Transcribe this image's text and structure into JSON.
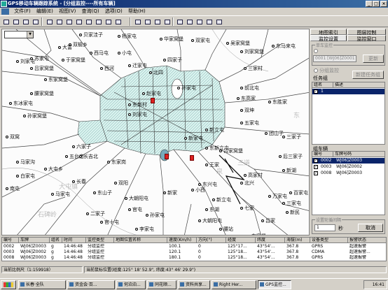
{
  "window": {
    "title": "GPS移动车辆跟踪系统 - [分组监控----所有车辆]",
    "min": "_",
    "max": "□",
    "close": "×"
  },
  "menu": [
    "文件(F)",
    "编辑(E)",
    "视图(V)",
    "查询(Q)",
    "选项(O)",
    "帮助(H)"
  ],
  "toolbar": {
    "icons": [
      "new-icon",
      "open-icon",
      "save-icon",
      "print-icon",
      "zoom-in-icon",
      "zoom-out-icon",
      "pan-icon",
      "select-icon",
      "locate-icon",
      "measure-icon",
      "layer-icon",
      "search-icon",
      "map-icon",
      "map-icon",
      "map-icon",
      "map-icon",
      "info-icon",
      "line-icon",
      "curve-icon",
      "stop-icon",
      "close-icon"
    ]
  },
  "map": {
    "combo_value": "",
    "places": [
      {
        "t": "贝家洼子",
        "c": "dark"
      },
      {
        "t": "杨家屯",
        "c": "dark"
      },
      {
        "t": "华家窝堡",
        "c": "dark"
      },
      {
        "t": "双家屯",
        "c": "dark"
      },
      {
        "t": "双榆乡",
        "c": "dark"
      },
      {
        "t": "吴家窝堡",
        "c": "dark"
      },
      {
        "t": "苏家屯",
        "c": "dark"
      },
      {
        "t": "于家窝堡",
        "c": "dark"
      },
      {
        "t": "西马屯",
        "c": "dark"
      },
      {
        "t": "小屯",
        "c": "dark"
      },
      {
        "t": "大富",
        "c": "dark"
      },
      {
        "t": "迁家屯",
        "c": "dark"
      },
      {
        "t": "四家子",
        "c": "dark"
      },
      {
        "t": "刘家窝堡",
        "c": "dark"
      },
      {
        "t": "东马来屯",
        "c": "dark"
      },
      {
        "t": "西河",
        "c": "dark"
      },
      {
        "t": "北四",
        "c": "dark"
      },
      {
        "t": "三家村",
        "c": "dark"
      },
      {
        "t": "刘家屯",
        "c": "dark"
      },
      {
        "t": "吕家窝堡",
        "c": "dark"
      },
      {
        "t": "孙家屯",
        "c": "dark"
      },
      {
        "t": "赵家屯",
        "c": "dark"
      },
      {
        "t": "东新村",
        "c": "dark"
      },
      {
        "t": "东家窝堡",
        "c": "dark"
      },
      {
        "t": "前北屯",
        "c": "dark"
      },
      {
        "t": "东高家",
        "c": "dark"
      },
      {
        "t": "刘家屯",
        "c": "dark"
      },
      {
        "t": "东胜家",
        "c": "dark"
      },
      {
        "t": "腰家窝堡",
        "c": "dark"
      },
      {
        "t": "东冰家屯",
        "c": "dark"
      },
      {
        "t": "孙家窝堡",
        "c": "dark"
      },
      {
        "t": "双坤",
        "c": "dark"
      },
      {
        "t": "六家子",
        "c": "dark"
      },
      {
        "t": "五台店",
        "c": "dark"
      },
      {
        "t": "长吉北",
        "c": "dark"
      },
      {
        "t": "双窝",
        "c": "dark"
      },
      {
        "t": "新立屯",
        "c": "dark"
      },
      {
        "t": "团山子",
        "c": "dark"
      },
      {
        "t": "新家屯",
        "c": "dark"
      },
      {
        "t": "马家沟",
        "c": "dark"
      },
      {
        "t": "东家岗",
        "c": "dark"
      },
      {
        "t": "三家子",
        "c": "dark"
      },
      {
        "t": "五家屯",
        "c": "dark"
      },
      {
        "t": "东新立屯",
        "c": "dark"
      },
      {
        "t": "吕家窝堡",
        "c": "dark"
      },
      {
        "t": "王家",
        "c": "dark"
      },
      {
        "t": "大屯乡",
        "c": "dark"
      },
      {
        "t": "白家屯",
        "c": "dark"
      },
      {
        "t": "长春",
        "c": "dark"
      },
      {
        "t": "双阳",
        "c": "dark"
      },
      {
        "t": "新家",
        "c": "dark"
      },
      {
        "t": "南屯",
        "c": "dark"
      },
      {
        "t": "马家屯",
        "c": "dark"
      },
      {
        "t": "东山子",
        "c": "dark"
      },
      {
        "t": "大朝阳屯",
        "c": "dark"
      },
      {
        "t": "小西",
        "c": "dark"
      },
      {
        "t": "北兴",
        "c": "dark"
      },
      {
        "t": "万家屯",
        "c": "dark"
      },
      {
        "t": "新湖",
        "c": "dark"
      },
      {
        "t": "高家村",
        "c": "dark"
      },
      {
        "t": "后三家子",
        "c": "dark"
      },
      {
        "t": "东兴屯",
        "c": "dark"
      },
      {
        "t": "七家",
        "c": "dark"
      },
      {
        "t": "新民",
        "c": "dark"
      },
      {
        "t": "吕家",
        "c": "dark"
      },
      {
        "t": "东湖",
        "c": "dark"
      },
      {
        "t": "腰站",
        "c": "dark"
      },
      {
        "t": "官屯",
        "c": "dark"
      },
      {
        "t": "孙家屯",
        "c": "dark"
      },
      {
        "t": "大朝阳屯",
        "c": "dark"
      },
      {
        "t": "二家子",
        "c": "dark"
      },
      {
        "t": "新立屯",
        "c": "dark"
      },
      {
        "t": "百家屯",
        "c": "dark"
      },
      {
        "t": "三家屯",
        "c": "dark"
      },
      {
        "t": "官十屯",
        "c": "dark"
      },
      {
        "t": "李家屯",
        "c": "dark"
      },
      {
        "t": "东窝堡",
        "c": "dark"
      },
      {
        "t": "大屯镇",
        "c": "light"
      },
      {
        "t": "石碑岭",
        "c": "light"
      },
      {
        "t": "三道",
        "c": "light"
      },
      {
        "t": "东",
        "c": "light"
      },
      {
        "t": "泉",
        "c": "light"
      }
    ]
  },
  "right_panel": {
    "tabs_top": [
      "地图索引",
      "图层控制"
    ],
    "tabs_bottom": [
      "监控设置",
      "监控窗口"
    ],
    "group1_legend": "单车监控",
    "vehicle_combo": "0001 [WJ06]Z0001",
    "modify_btn": "更新",
    "group2_legend": "分组监控",
    "new_task_btn": "新建任务组",
    "task_group_label": "任务组",
    "task_headers": [
      "组名",
      "描述"
    ],
    "task_rows": [
      {
        "name": "1",
        "desc": ""
      }
    ],
    "vehicle_label": "组车辆",
    "vehicle_headers": [
      "编号",
      "车牌号码"
    ],
    "vehicle_rows": [
      {
        "id": "0002",
        "plate": "WJ06]Z0003"
      },
      {
        "id": "0003",
        "plate": "WJ06]Z0002"
      },
      {
        "id": "0008",
        "plate": "WJ06]Z0003"
      }
    ],
    "interval_legend": "设置轮循间隔",
    "interval_value": "1",
    "interval_unit": "秒",
    "cancel_btn": "取消"
  },
  "bottom_table": {
    "headers": [
      "编号",
      "车牌",
      "组名",
      "时间",
      "监控类型",
      "地图位置名称",
      "速度(Km/h)",
      "方向(°)",
      "经度",
      "纬度",
      "海拔(m)",
      "设备类型",
      "报警状态"
    ],
    "rows": [
      [
        "0002",
        "WJ06]Z0003",
        "g",
        "14:46:48",
        "分组监控",
        "",
        "100.1",
        "0",
        "125°17...",
        "43°54'...",
        "367.8",
        "GPRS",
        "超速报警"
      ],
      [
        "0003",
        "WJ06]Z0002",
        "g",
        "14:46:48",
        "分组监控",
        "",
        "120.1",
        "0",
        "125°18...",
        "43°54'...",
        "367.8",
        "CDMA",
        "超速报警..."
      ],
      [
        "0008",
        "WJ06]Z0003",
        "g",
        "14:46:48",
        "分组监控",
        "",
        "180.1",
        "0",
        "125°18...",
        "43°54'...",
        "367.8",
        "GPRS",
        "超速报警"
      ]
    ]
  },
  "status": {
    "scale": "当前比例尺（1:159918）",
    "position": "当前鼠标位置(经度:125° 18' 52.9\", 纬度:43° 46' 29.9\")"
  },
  "taskbar": {
    "start": "",
    "tasks": [
      "长春·全队",
      "资金会·百...",
      "何泊泊...",
      "同花顺...",
      "资料共享...",
      "Right Her...",
      "GPS监控..."
    ],
    "clock": "16:41"
  }
}
